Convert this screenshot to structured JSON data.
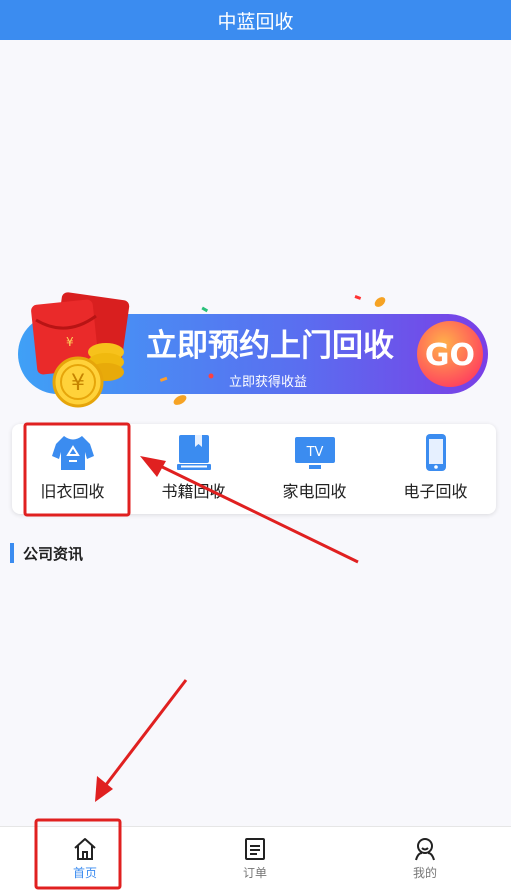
{
  "header": {
    "title": "中蓝回收"
  },
  "banner": {
    "headline": "立即预约上门回收",
    "subline": "立即获得收益",
    "go_label": "GO",
    "coin_symbol": "¥"
  },
  "menu": {
    "items": [
      {
        "label": "旧衣回收",
        "icon": "shirt-recycle-icon"
      },
      {
        "label": "书籍回收",
        "icon": "book-icon"
      },
      {
        "label": "家电回收",
        "icon": "tv-icon"
      },
      {
        "label": "电子回收",
        "icon": "phone-icon"
      }
    ]
  },
  "section": {
    "title": "公司资讯"
  },
  "tabbar": {
    "items": [
      {
        "label": "首页",
        "icon": "home-icon",
        "active": true
      },
      {
        "label": "订单",
        "icon": "order-icon",
        "active": false
      },
      {
        "label": "我的",
        "icon": "user-icon",
        "active": false
      }
    ]
  },
  "tv_icon_text": "TV",
  "colors": {
    "primary": "#3b8cf0",
    "annotation": "#e02020",
    "banner_gradient": [
      "#3a8ef5",
      "#7a3fe6"
    ],
    "go_button": "#ff5a2c"
  }
}
